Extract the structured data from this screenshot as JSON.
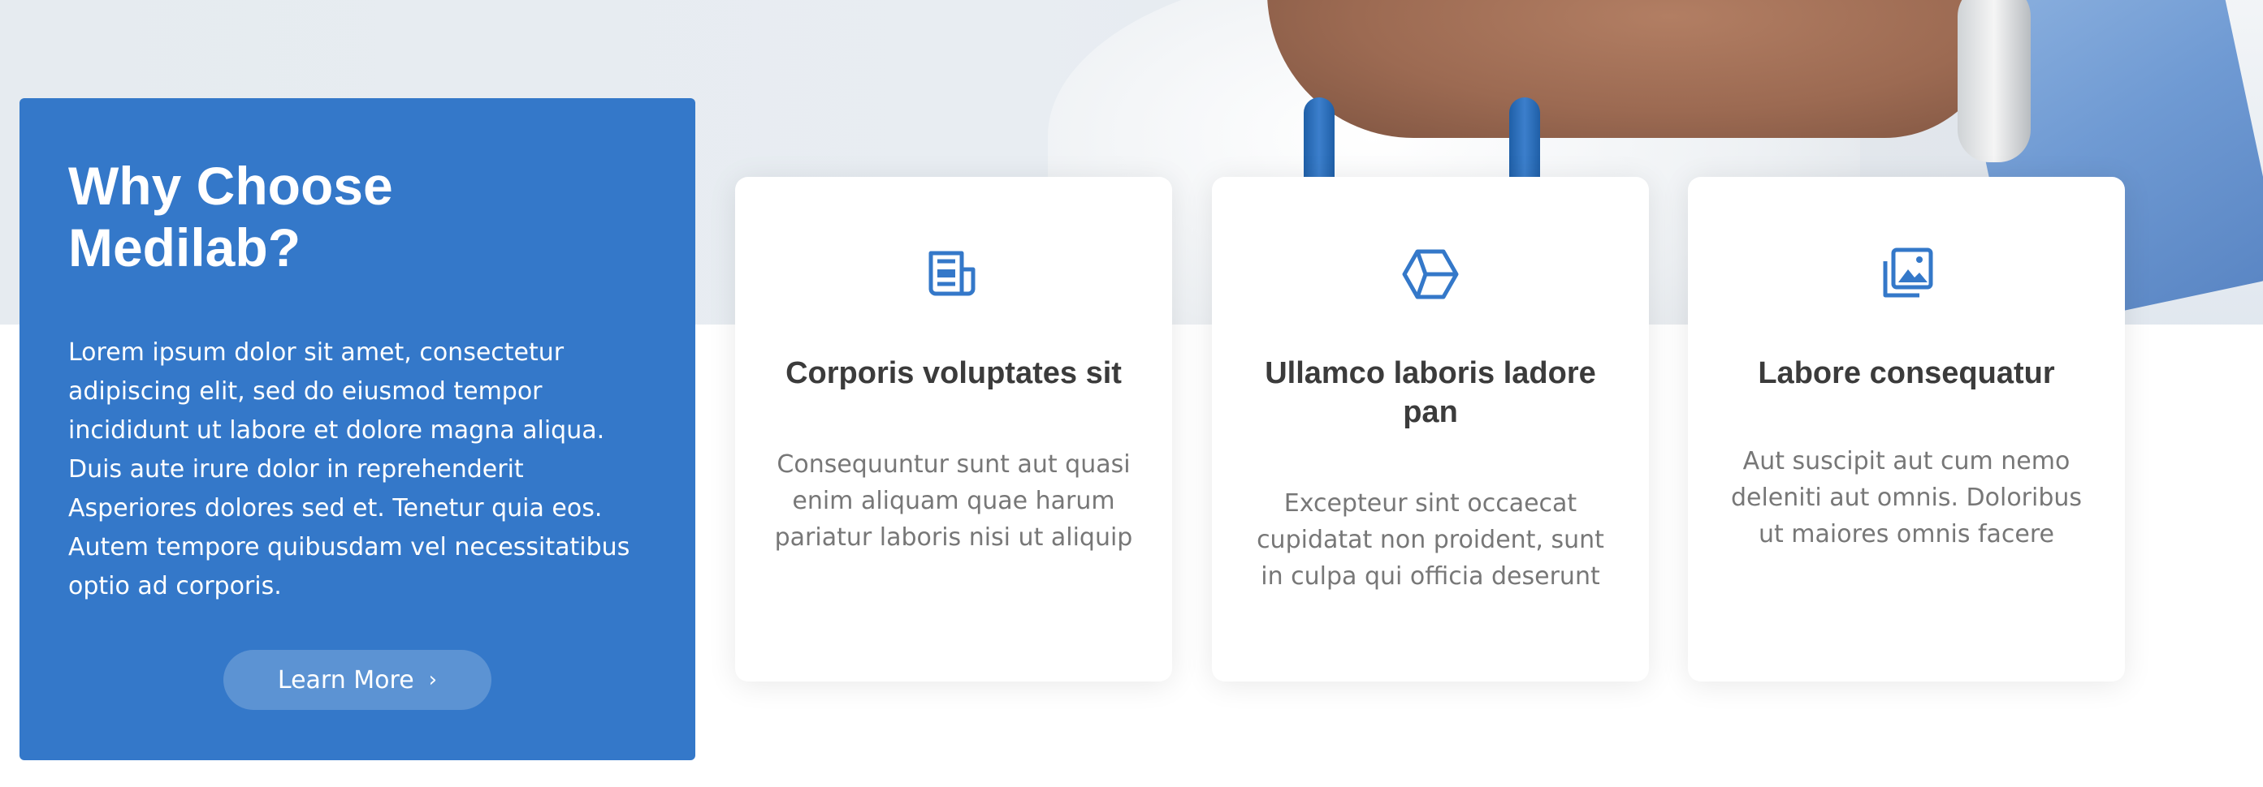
{
  "why": {
    "title": "Why Choose Medilab?",
    "text": "Lorem ipsum dolor sit amet, consectetur adipiscing elit, sed do eiusmod tempor incididunt ut labore et dolore magna aliqua. Duis aute irure dolor in reprehenderit Asperiores dolores sed et. Tenetur quia eos. Autem tempore quibusdam vel necessitatibus optio ad corporis.",
    "button_label": "Learn More",
    "accent": "#3478c9"
  },
  "cards": [
    {
      "icon": "newspaper-icon",
      "title": "Corporis voluptates sit",
      "desc": "Consequuntur sunt aut quasi enim aliquam quae harum pariatur laboris nisi ut aliquip"
    },
    {
      "icon": "box-icon",
      "title": "Ullamco laboris ladore pan",
      "desc": "Excepteur sint occaecat cupidatat non proident, sunt in culpa qui officia deserunt"
    },
    {
      "icon": "images-icon",
      "title": "Labore consequatur",
      "desc": "Aut suscipit aut cum nemo deleniti aut omnis. Doloribus ut maiores omnis facere"
    }
  ]
}
